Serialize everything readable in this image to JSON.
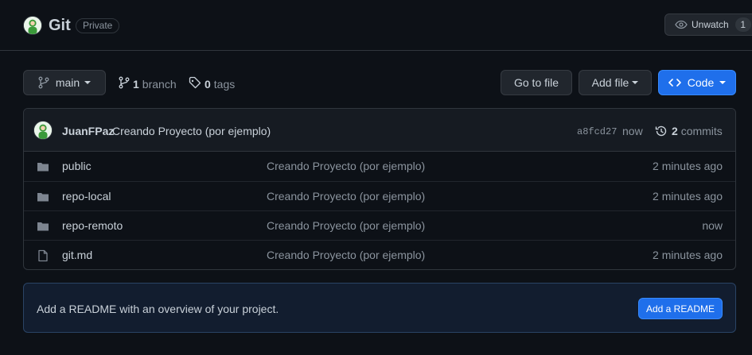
{
  "repo": {
    "name": "Git",
    "visibility": "Private",
    "unwatch_label": "Unwatch",
    "watch_count": "1"
  },
  "toolbar": {
    "branch_label": "main",
    "branch_count": "1",
    "branch_word": "branch",
    "tag_count": "0",
    "tag_word": "tags",
    "go_to_file": "Go to file",
    "add_file": "Add file",
    "code": "Code"
  },
  "commit": {
    "author": "JuanFPaz",
    "message": "Creando Proyecto (por ejemplo)",
    "sha": "a8fcd27",
    "time": "now",
    "commits_count": "2",
    "commits_word": "commits"
  },
  "files": [
    {
      "name": "public",
      "type": "folder",
      "message": "Creando Proyecto (por ejemplo)",
      "age": "2 minutes ago"
    },
    {
      "name": "repo-local",
      "type": "folder",
      "message": "Creando Proyecto (por ejemplo)",
      "age": "2 minutes ago"
    },
    {
      "name": "repo-remoto",
      "type": "folder",
      "message": "Creando Proyecto (por ejemplo)",
      "age": "now"
    },
    {
      "name": "git.md",
      "type": "file",
      "message": "Creando Proyecto (por ejemplo)",
      "age": "2 minutes ago"
    }
  ],
  "readme": {
    "text": "Add a README with an overview of your project.",
    "button": "Add a README"
  },
  "colors": {
    "background": "#0d1117",
    "primary": "#1f6feb",
    "border": "#30363d"
  }
}
